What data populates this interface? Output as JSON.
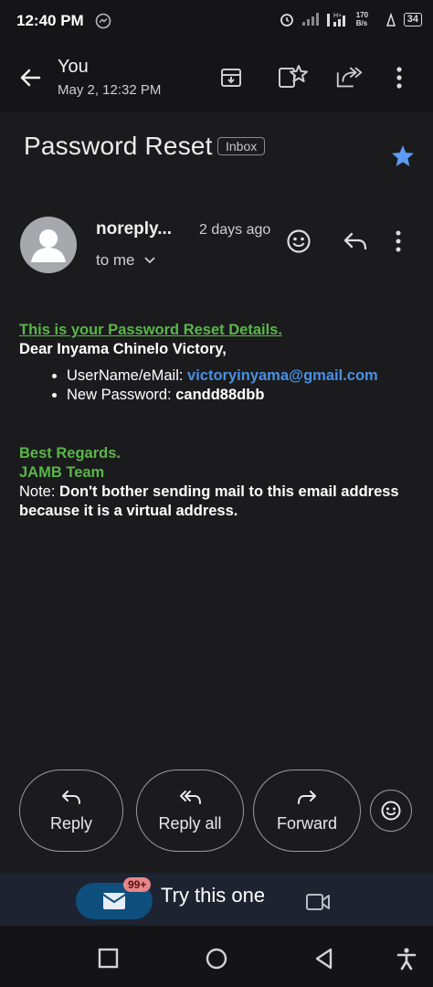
{
  "status_bar": {
    "time": "12:40 PM",
    "network_speed": "170 B/s",
    "battery": "34"
  },
  "app_bar": {
    "title": "You",
    "date": "May 2, 12:32 PM"
  },
  "subject": "Password Reset",
  "label": "Inbox",
  "sender": {
    "name": "noreply...",
    "time": "2 days ago",
    "recipient": "to me"
  },
  "email": {
    "heading": "This is your Password Reset Details.",
    "greeting": "Dear Inyama Chinelo Victory,",
    "username_label": "UserName/eMail: ",
    "username_value": "victoryinyama@gmail.com",
    "password_label": "New Password: ",
    "password_value": "candd88dbb",
    "regards": "Best Regards.",
    "team": "JAMB Team",
    "note_label": "Note: ",
    "note_text": "Don't bother sending mail to this email address because it is a virtual address."
  },
  "actions": {
    "reply": "Reply",
    "reply_all": "Reply all",
    "forward": "Forward"
  },
  "bottom_nav": {
    "badge": "99+",
    "meet_text": "Try this one"
  },
  "colors": {
    "background": "#1b1b1d",
    "accent_green": "#59b649",
    "link_blue": "#4a90e2",
    "star_blue": "#5b9cf5"
  }
}
